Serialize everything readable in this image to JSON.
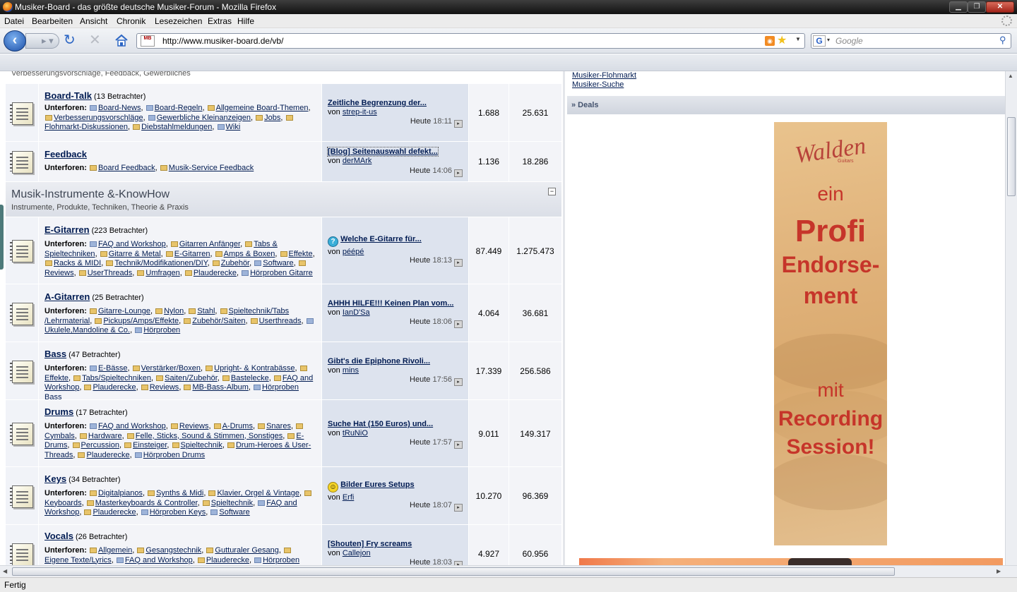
{
  "window": {
    "title": "Musiker-Board - das größte deutsche Musiker-Forum - Mozilla Firefox"
  },
  "menu": [
    "Datei",
    "Bearbeiten",
    "Ansicht",
    "Chronik",
    "Lesezeichen",
    "Extras",
    "Hilfe"
  ],
  "nav": {
    "url": "http://www.musiker-board.de/vb/",
    "search_placeholder": "Google",
    "favicon_text": "MB"
  },
  "status": "Fertig",
  "partial_top": "Verbesserungsvorschläge, Feedback, Gewerbliches",
  "category": {
    "title": "Musik-Instrumente &-KnowHow",
    "desc": "Instrumente, Produkte, Techniken, Theorie & Praxis",
    "collapse": "−"
  },
  "labels": {
    "subforums": "Unterforen:",
    "by": "von",
    "today": "Heute"
  },
  "forums": [
    {
      "name": "Board-Talk",
      "viewers": "(13 Betrachter)",
      "subs": [
        "Board-News",
        "Board-Regeln",
        "Allgemeine Board-Themen",
        "Verbesserungsvorschläge",
        "Gewerbliche Kleinanzeigen",
        "Jobs",
        "Flohmarkt-Diskussionen",
        "Diebstahlmeldungen",
        "Wiki"
      ],
      "last_title": "Zeitliche Begrenzung der...",
      "last_user": "strep-it-us",
      "last_time": "18:11",
      "threads": "1.688",
      "posts": "25.631"
    },
    {
      "name": "Feedback",
      "viewers": "",
      "subs": [
        "Board Feedback",
        "Musik-Service Feedback"
      ],
      "last_title": "[Blog] Seitenauswahl defekt...",
      "last_user": "derMArk",
      "last_time": "14:06",
      "threads": "1.136",
      "posts": "18.286"
    },
    {
      "name": "E-Gitarren",
      "viewers": "(223 Betrachter)",
      "subs": [
        "FAQ and Workshop",
        "Gitarren Anfänger",
        "Tabs & Spieltechniken",
        "Gitarre & Metal",
        "E-Gitarren",
        "Amps & Boxen",
        "Effekte",
        "Racks & MIDI",
        "Technik/Modifikationen/DIY",
        "Zubehör",
        "Software",
        "Reviews",
        "UserThreads",
        "Umfragen",
        "Plauderecke",
        "Hörproben Gitarre"
      ],
      "last_title": "Welche E-Gitarre für...",
      "last_user": "péépé",
      "last_time": "18:13",
      "threads": "87.449",
      "posts": "1.275.473"
    },
    {
      "name": "A-Gitarren",
      "viewers": "(25 Betrachter)",
      "subs": [
        "Gitarre-Lounge",
        "Nylon",
        "Stahl",
        "Spieltechnik/Tabs /Lehrmaterial",
        "Pickups/Amps/Effekte",
        "Zubehör/Saiten",
        "Userthreads",
        "Ukulele,Mandoline & Co.",
        "Hörproben"
      ],
      "last_title": "AHHH HILFE!!! Keinen Plan vom...",
      "last_user": "IanD'Sa",
      "last_time": "18:06",
      "threads": "4.064",
      "posts": "36.681"
    },
    {
      "name": "Bass",
      "viewers": "(47 Betrachter)",
      "subs": [
        "E-Bässe",
        "Verstärker/Boxen",
        "Upright- & Kontrabässe",
        "Effekte",
        "Tabs/Spieltechniken",
        "Saiten/Zubehör",
        "Bastelecke",
        "FAQ and Workshop",
        "Plauderecke",
        "Reviews",
        "MB-Bass-Album",
        "Hörproben Bass"
      ],
      "last_title": "Gibt's die Epiphone Rivoli...",
      "last_user": "mins",
      "last_time": "17:56",
      "threads": "17.339",
      "posts": "256.586"
    },
    {
      "name": "Drums",
      "viewers": "(17 Betrachter)",
      "subs": [
        "FAQ and Workshop",
        "Reviews",
        "A-Drums",
        "Snares",
        "Cymbals",
        "Hardware",
        "Felle, Sticks, Sound & Stimmen, Sonstiges",
        "E-Drums",
        "Percussion",
        "Einsteiger",
        "Spieltechnik",
        "Drum-Heroes & User-Threads",
        "Plauderecke",
        "Hörproben Drums"
      ],
      "last_title": "Suche Hat (150 Euros) und...",
      "last_user": "tRuNiO",
      "last_time": "17:57",
      "threads": "9.011",
      "posts": "149.317"
    },
    {
      "name": "Keys",
      "viewers": "(34 Betrachter)",
      "subs": [
        "Digitalpianos",
        "Synths & Midi",
        "Klavier, Orgel & Vintage",
        "Keyboards",
        "Masterkeyboards & Controller",
        "Spieltechnik",
        "FAQ and Workshop",
        "Plauderecke",
        "Hörproben Keys",
        "Software"
      ],
      "last_title": "Bilder Eures Setups",
      "last_user": "Erfi",
      "last_time": "18:07",
      "threads": "10.270",
      "posts": "96.369"
    },
    {
      "name": "Vocals",
      "viewers": "(26 Betrachter)",
      "subs": [
        "Allgemein",
        "Gesangstechnik",
        "Gutturaler Gesang",
        "Eigene Texte/Lyrics",
        "FAQ and Workshop",
        "Plauderecke",
        "Hörproben"
      ],
      "last_title": "[Shouten] Fry screams",
      "last_user": "Callejon",
      "last_time": "18:03",
      "threads": "4.927",
      "posts": "60.956"
    }
  ],
  "sidebar": {
    "links": [
      "Musiker-Flohmarkt",
      "Musiker-Suche"
    ],
    "deals": "» Deals"
  },
  "ad": {
    "brand": "Walden",
    "brand_sub": "Guitars",
    "lines": [
      "ein",
      "Profi",
      "Endorse-",
      "ment",
      "mit",
      "Recording",
      "Session!"
    ]
  }
}
